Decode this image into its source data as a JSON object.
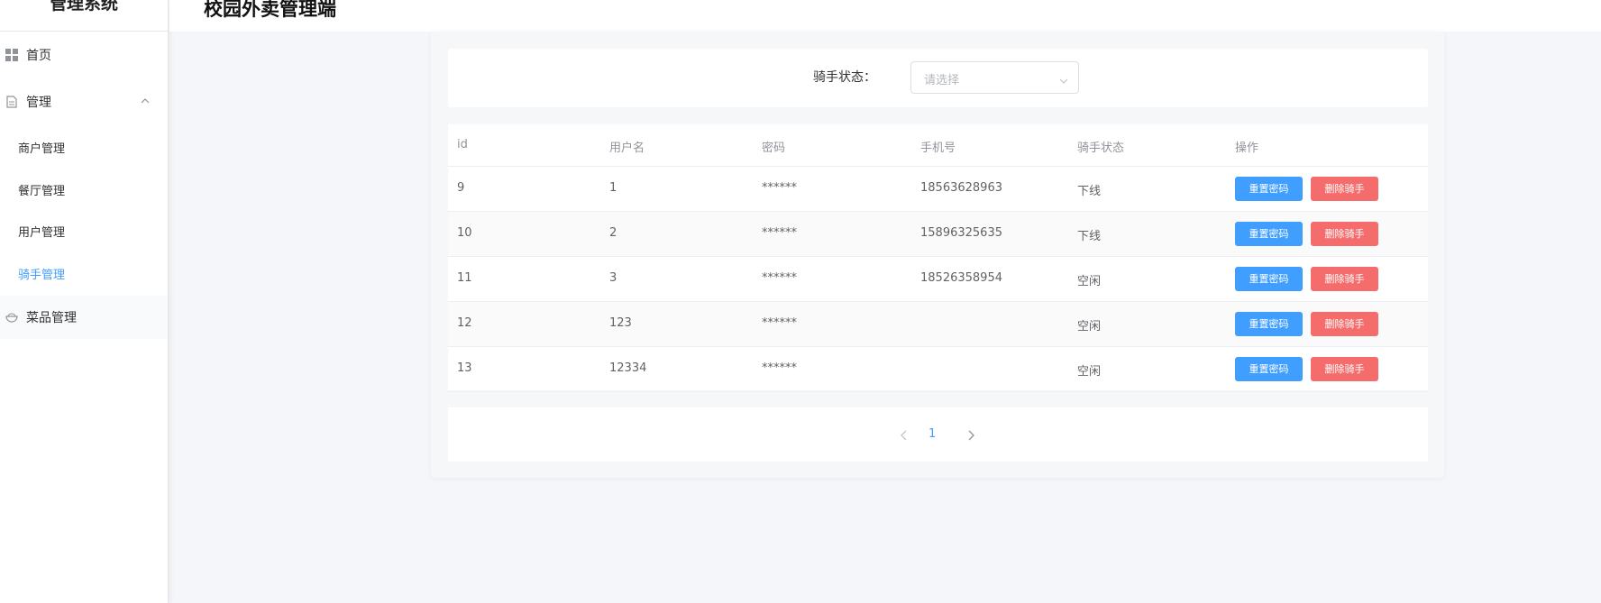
{
  "sidebar": {
    "title": "管理系统",
    "home": "首页",
    "manage": "管理",
    "sub_items": [
      "商户管理",
      "餐厅管理",
      "用户管理",
      "骑手管理"
    ],
    "dishes": "菜品管理"
  },
  "header": {
    "title": "校园外卖管理端"
  },
  "filter": {
    "label": "骑手状态：",
    "placeholder": "请选择"
  },
  "table": {
    "columns": [
      "id",
      "用户名",
      "密码",
      "手机号",
      "骑手状态",
      "操作"
    ],
    "rows": [
      {
        "id": "9",
        "username": "1",
        "password": "******",
        "phone": "18563628963",
        "status": "下线"
      },
      {
        "id": "10",
        "username": "2",
        "password": "******",
        "phone": "15896325635",
        "status": "下线"
      },
      {
        "id": "11",
        "username": "3",
        "password": "******",
        "phone": "18526358954",
        "status": "空闲"
      },
      {
        "id": "12",
        "username": "123",
        "password": "******",
        "phone": "",
        "status": "空闲"
      },
      {
        "id": "13",
        "username": "12334",
        "password": "******",
        "phone": "",
        "status": "空闲"
      }
    ],
    "reset_label": "重置密码",
    "delete_label": "删除骑手"
  },
  "pagination": {
    "current": "1"
  },
  "colors": {
    "primary": "#409eff",
    "danger": "#f56c6c",
    "active_menu": "#409eff"
  }
}
